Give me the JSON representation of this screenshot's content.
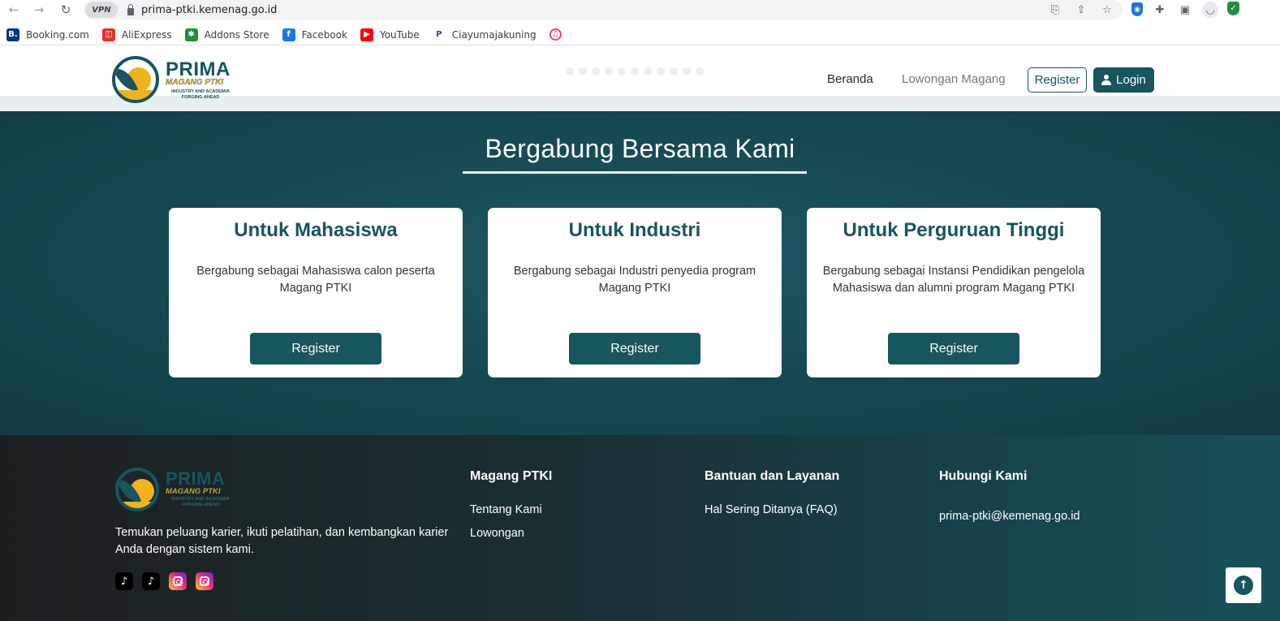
{
  "browser": {
    "url": "prima-ptki.kemenag.go.id",
    "vpn_label": "VPN",
    "bookmarks": [
      {
        "label": "Booking.com",
        "icon": "booking-icon",
        "color": "#003580",
        "glyph": "B."
      },
      {
        "label": "AliExpress",
        "icon": "aliexpress-icon",
        "color": "#e43225",
        "glyph": "◫"
      },
      {
        "label": "Addons Store",
        "icon": "addons-store-icon",
        "color": "#1e8e3e",
        "glyph": "✱"
      },
      {
        "label": "Facebook",
        "icon": "facebook-icon",
        "color": "#1877f2",
        "glyph": "f"
      },
      {
        "label": "YouTube",
        "icon": "youtube-icon",
        "color": "#ff0000",
        "glyph": "▶"
      },
      {
        "label": "Ciayumajakuning",
        "icon": "ciayumajakuning-icon",
        "color": "#ffffff",
        "glyph": "P"
      }
    ]
  },
  "site": {
    "logo": {
      "title": "PRIMA",
      "subtitle": "MAGANG PTKI",
      "tagline": "INDUSTRY AND ACADEMIA FORGING AHEAD"
    },
    "nav": {
      "home": "Beranda",
      "vacancies": "Lowongan Magang",
      "register": "Register",
      "login": "Login"
    },
    "brand_color": "#17555f"
  },
  "join": {
    "title": "Bergabung Bersama Kami",
    "cards": [
      {
        "title": "Untuk Mahasiswa",
        "text": "Bergabung sebagai Mahasiswa calon peserta Magang PTKI",
        "button": "Register"
      },
      {
        "title": "Untuk Industri",
        "text": "Bergabung sebagai Industri penyedia program Magang PTKI",
        "button": "Register"
      },
      {
        "title": "Untuk Perguruan Tinggi",
        "text": "Bergabung sebagai Instansi Pendidikan pengelola Mahasiswa dan alumni program Magang PTKI",
        "button": "Register"
      }
    ]
  },
  "footer": {
    "description": "Temukan peluang karier, ikuti pelatihan, dan kembangkan karier Anda dengan sistem kami.",
    "col1": {
      "title": "Magang PTKI",
      "links": [
        "Tentang Kami",
        "Lowongan"
      ]
    },
    "col2": {
      "title": "Bantuan dan Layanan",
      "links": [
        "Hal Sering Ditanya (FAQ)"
      ]
    },
    "col3": {
      "title": "Hubungi Kami",
      "email": "prima-ptki@kemenag.go.id"
    },
    "socials": [
      "tiktok-icon",
      "tiktok-icon",
      "instagram-icon",
      "instagram-icon"
    ]
  }
}
